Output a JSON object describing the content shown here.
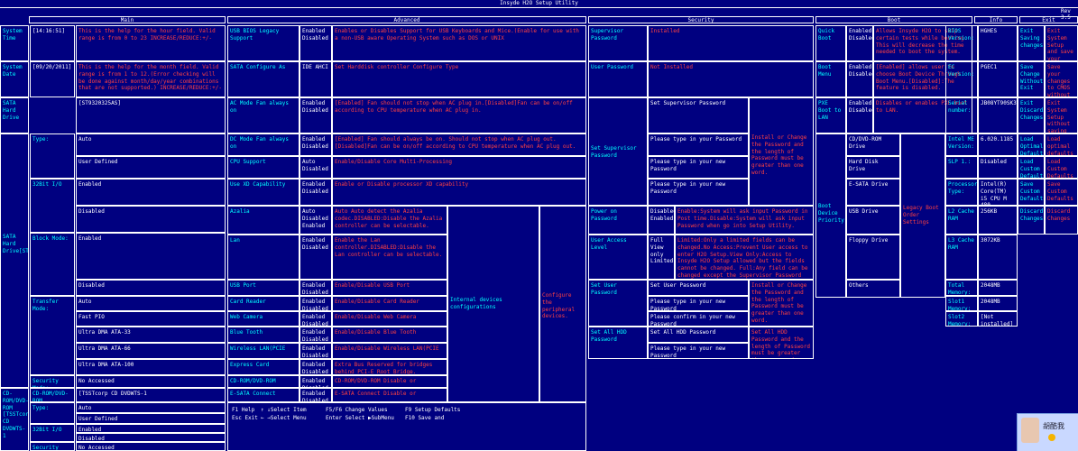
{
  "window_title": "Insyde H2O Setup Utility",
  "revision": "Rev 3.5",
  "tabs": [
    {
      "label": "Main"
    },
    {
      "label": "Advanced"
    },
    {
      "label": "Security"
    },
    {
      "label": "Boot"
    },
    {
      "label": "Info"
    },
    {
      "label": "Exit"
    }
  ],
  "main": {
    "rows": [
      {
        "label": "System Time",
        "value": "[14:16:51]",
        "help": "This is the help for the hour field. Valid range is from 0 to 23 INCREASE/REDUCE:+/-"
      },
      {
        "label": "System Date",
        "value": "[09/20/2011]",
        "help": "This is the help for the month field. Valid range is from 1 to 12.(Error checking will be done against month/day/year combinations that are not supported.) INCREASE/REDUCE:+/-"
      },
      {
        "label": "SATA Hard Drive",
        "value": "[ST9320325AS]"
      },
      {
        "label": "Type:",
        "values": [
          "Auto",
          "User Defined"
        ]
      },
      {
        "label": "32Bit I/O",
        "values": [
          "Enabled",
          "Disabled"
        ]
      },
      {
        "label": "Block Mode:",
        "values": [
          "Enabled",
          "Disabled"
        ]
      },
      {
        "label": "Transfer Mode:",
        "values": [
          "Auto",
          "Fast PIO",
          "Ultra DMA ATA-33",
          "Ultra DMA ATA-66",
          "Ultra DMA ATA-100"
        ]
      },
      {
        "label": "Security Mode:",
        "value": "No Accessed"
      },
      {
        "label": "CD-ROM/DVD-ROM",
        "value": "[TSSTcorp CD DVDWTS-1"
      },
      {
        "label": "Type:",
        "values": [
          "Auto",
          "User Defined"
        ]
      },
      {
        "label": "32Bit I/O",
        "values": [
          "Enabled",
          "Disabled"
        ]
      },
      {
        "label": "Security Mode:",
        "value": "No Accessed"
      }
    ],
    "left_device_1": "SATA Hard Drive[ST9320325AS]",
    "left_device_2": "CD-ROM/DVD-ROM [TSSTcorp CD DVDWTS-1"
  },
  "advanced": {
    "rows": [
      {
        "label": "USB BIOS Legacy Support",
        "values": "Enabled Disabled",
        "help": "Enables or Disables Support for USB Keyboards and Mice.(Enable for use with a non-USB aware Operating System such as DOS or UNIX"
      },
      {
        "label": "SATA Configure As",
        "values": "IDE AHCI",
        "help": "Set Harddisk controller Configure Type"
      },
      {
        "label": "AC Mode Fan always on",
        "values": "Enabled Disabled",
        "help": "[Enabled] Fan should not stop when AC plug in.[Disabled]Fan can be on/off according to CPU temperature when AC plug in."
      },
      {
        "label": "DC Mode Fan always on",
        "values": "Enabled Disabled",
        "help": "[Enabled] Fan should always be on. Should not stop when AC plug out.[Disabled]Fan can be on/off according to CPU temperature when AC plug out."
      },
      {
        "label": "CPU Support",
        "values": "Auto Disabled",
        "help": "Enable/Disable Core Multi-Processing"
      },
      {
        "label": "Use XD Capability",
        "values": "Enabled Disabled",
        "help": "Enable or Disable processor XD capability"
      },
      {
        "label": "Azalia",
        "values": "Auto Disabled Enabled",
        "help": "Auto Auto detect the Azalia codec.DISABLED:Disable the Azalia controller can be selectable."
      },
      {
        "label": "Lan",
        "values": "Enabled Disabled",
        "help": "Enable the Lan controller.DISABLED:Disable the Lan controller can be selectable."
      },
      {
        "label": "USB Port",
        "values": "Enabled Disabled",
        "help": "Enable/Disable USB Port"
      },
      {
        "label": "Card Reader",
        "values": "Enabled Disabled",
        "help": "Enable/Disable Card Reader"
      },
      {
        "label": "Web Camera",
        "values": "Enabled Disabled",
        "help": "Enable/Disable Web Camera"
      },
      {
        "label": "Blue Tooth",
        "values": "Enabled Disabled",
        "help": "Enable/Disable Blue Tooth"
      },
      {
        "label": "Wireless LAN(PCIE",
        "values": "Enabled Disabled",
        "help": "Enable/Disable Wireless LAN(PCIE"
      },
      {
        "label": "Express Card",
        "values": "Enabled Disabled",
        "help": "Extra Bus Reserved for bridges behind PCI-E Root Bridge."
      },
      {
        "label": "CD-ROM/DVD-ROM",
        "values": "Enabled Disabled",
        "help": "CD-ROM/DVD-ROM Disable or"
      },
      {
        "label": "E-SATA Connect",
        "values": "Enabled Disabled",
        "help": "E-SATA Connect Disable or"
      }
    ],
    "internal_devices": "Internal devices configurations",
    "peripheral": "Configure the peripheral devices."
  },
  "security": {
    "supervisor_password": "Supervisor Password",
    "supervisor_status": "Installed",
    "user_password": "User Password",
    "user_status": "Not Installed",
    "set_supervisor": "Set Supervisor Password",
    "set_supervisor_label": "Set Supervisor Password",
    "type_pw": "Please type in your Password",
    "type_new_pw": "Please type in your new Password",
    "type_new_pw2": "Please type in your new Password",
    "install_help": "Install or Change the Password and the length of Password must be greater than one word.",
    "power_on": "Power on Password",
    "power_on_vals": "Disabled Enabled",
    "power_on_help": "Enable:System will ask input Password in Post time.Disable:System will ask input Password when go into Setup Utility.",
    "user_access": "User Access Level",
    "user_access_vals": "Full View only Limited",
    "user_access_help": "Limited:Only a limited fields can be changed.No Access:Prevent User access to enter H2O Setup.View Only:Access to Insyde H2O Setup allowed but the fields cannot be changed. Full:Any field can be changed except the Supervisor Password",
    "set_user": "Set User Password",
    "set_user_label": "Set User Password",
    "pw_new": "Please type in your new Password",
    "pw_confirm": "Please confirm in your new Password",
    "user_help": "Install or Change the Password and the length of Password must be greater than one word.",
    "set_hdd": "Set All HDD Password",
    "set_hdd_label": "Set All HDD Password",
    "hdd_new": "Please type in your new Password",
    "hdd_help": "Set All HDD Password and the length of Password must be greater than one word."
  },
  "boot": {
    "quick": "Quick Boot",
    "quick_vals": "Enabled Disabled",
    "quick_help": "Allows Insyde H2O to skip certain tests while booting. This will decrease the time needed to boot the system.",
    "menu": "Boot Menu",
    "menu_vals": "Enabled Disabled",
    "menu_help": "[Enabled] allows user to choose Boot Device Through Boot Menu.[Disabled]:The feature is disabled.",
    "pxe": "PXE Boot to LAN",
    "pxe_vals": "Enabled Disabled",
    "pxe_help": "Disables or enables PXE boot to LAN.",
    "priority": "Boot Device Priority",
    "devices": [
      "CD/DVD-ROM Drive",
      "Hard Disk Drive",
      "E-SATA Drive",
      "USB Drive",
      "Floppy Drive",
      "Others"
    ],
    "legacy": "Legacy Boot Order Settings"
  },
  "info": {
    "items": [
      {
        "k": "BIOS Version:",
        "v": "HGHES"
      },
      {
        "k": "EC Version:",
        "v": "PGEC1"
      },
      {
        "k": "Serial number:",
        "v": "JB08YT90SK3TA5A4465"
      },
      {
        "k": "Intel ME Version:",
        "v": "6.020.1185"
      },
      {
        "k": "SLP 1.:",
        "v": "Disabled"
      },
      {
        "k": "Processor Type:",
        "v": "Intel(R) Core(TM) i5 CPU M 480 @2.67GHz"
      },
      {
        "k": "L2 Cache RAM",
        "v": "256KB"
      },
      {
        "k": "L3 Cache RAM",
        "v": "3072KB"
      },
      {
        "k": "Total Memory:",
        "v": "2048MB"
      },
      {
        "k": "Slot1 Memory:",
        "v": "2048MB"
      },
      {
        "k": "Slot2 Memory:",
        "v": "[Not installed]"
      }
    ]
  },
  "exit": {
    "items": [
      {
        "k": "Exit Saving changes",
        "v": "Exit System Setup and save your changes"
      },
      {
        "k": "Save Change Without Exit",
        "v": "Save your changes to CMOS without Exiting"
      },
      {
        "k": "Exit Discarding Changes",
        "v": "Exit System Setup without saving any changes."
      },
      {
        "k": "Load Optimal Defaults",
        "v": "Load optimal defaults"
      },
      {
        "k": "Load Custom Defaults",
        "v": "Load Custom Defaults"
      },
      {
        "k": "Save Custom Defaults",
        "v": "Save Custom Defaults"
      },
      {
        "k": "Discard Changes",
        "v": "Discard Changes"
      }
    ]
  },
  "footer": {
    "f1": "F1 Help",
    "esc": "Esc Exit",
    "updown": "↑ ↓Select Item",
    "leftright": "← →Select Menu",
    "f56": "F5/F6 Change Values",
    "enter": "Enter Select ▶SubMenu",
    "f9": "F9 Setup Defaults",
    "f10": "F10 Save and"
  },
  "chat": {
    "name": "胡酷我"
  }
}
